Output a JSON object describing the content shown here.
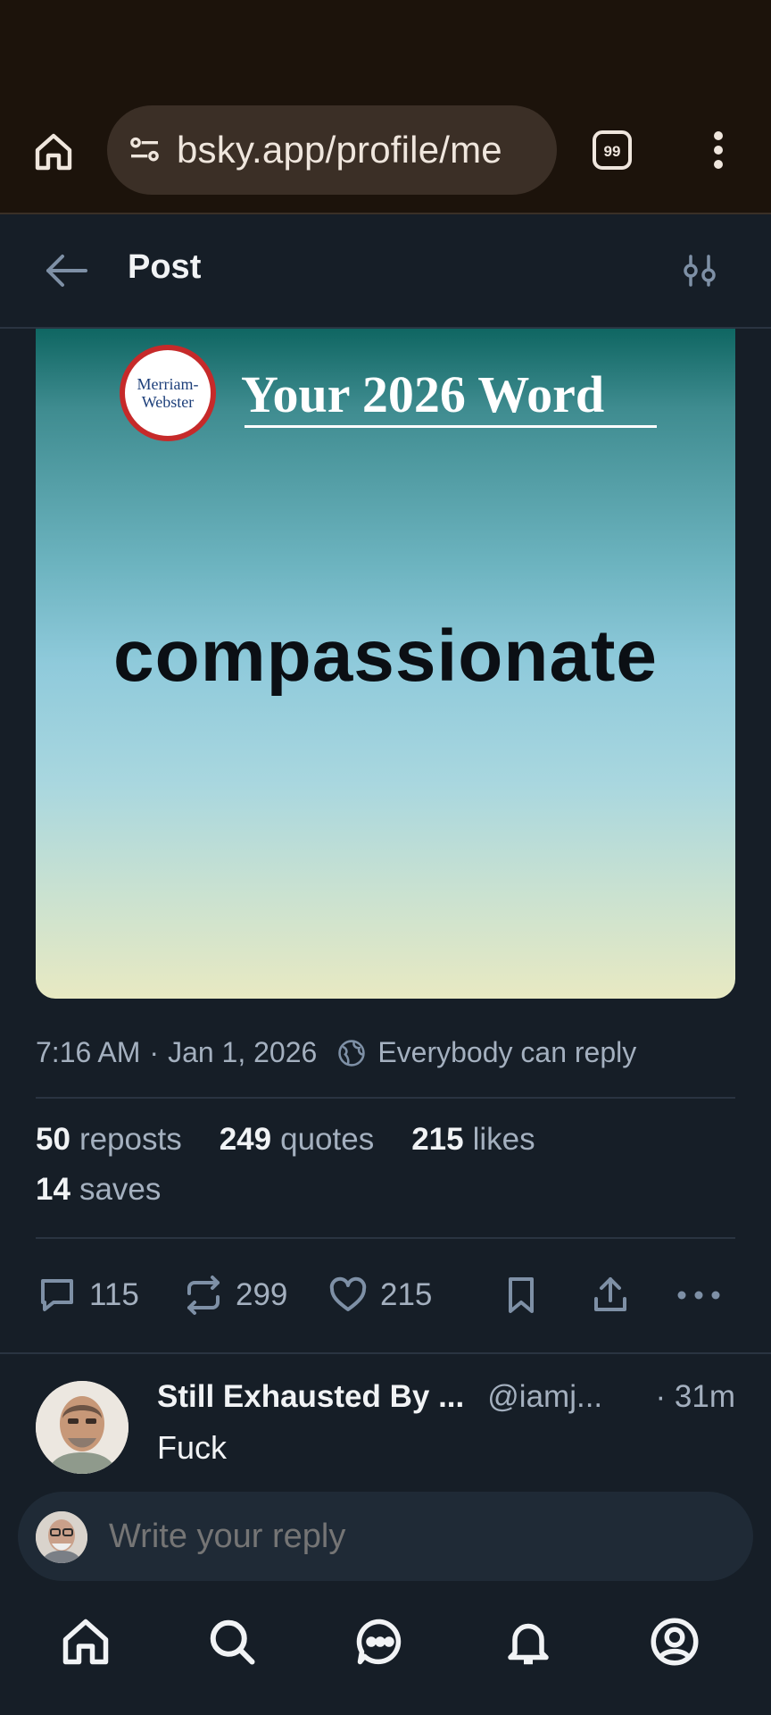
{
  "browser": {
    "url": "bsky.app/profile/me",
    "tab_count": "99"
  },
  "header": {
    "title": "Post"
  },
  "image": {
    "logo_text_line1": "Merriam-",
    "logo_text_line2": "Webster",
    "heading": "Your 2026 Word",
    "word": "compassionate"
  },
  "meta": {
    "time": "7:16 AM",
    "date": "Jan 1, 2026",
    "reply_setting": "Everybody can reply"
  },
  "stats": {
    "reposts_count": "50",
    "reposts_label": "reposts",
    "quotes_count": "249",
    "quotes_label": "quotes",
    "likes_count": "215",
    "likes_label": "likes",
    "saves_count": "14",
    "saves_label": "saves"
  },
  "actions": {
    "replies": "115",
    "reposts": "299",
    "likes": "215"
  },
  "reply": {
    "name": "Still Exhausted By ...",
    "handle": "@iamj...",
    "time": "· 31m",
    "text": "Fuck"
  },
  "composer": {
    "placeholder": "Write your reply"
  },
  "colors": {
    "background": "#161e27",
    "muted_text": "#a4b0bf",
    "browser_bar": "#1c130b"
  }
}
